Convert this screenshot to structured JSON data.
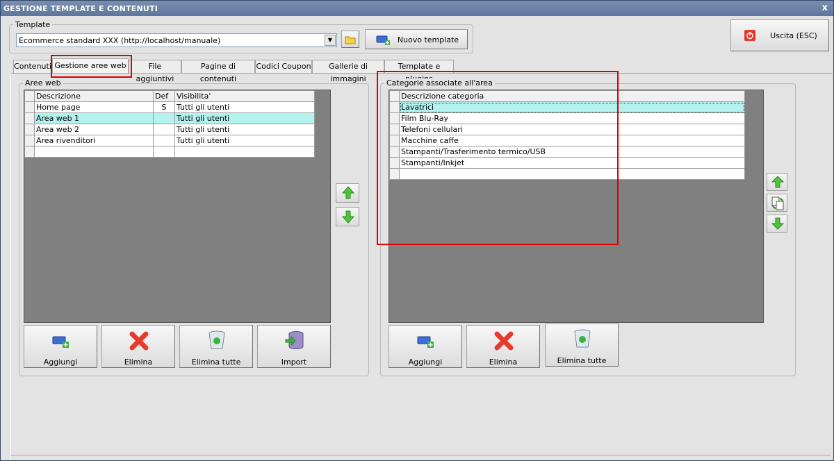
{
  "window": {
    "title": "GESTIONE TEMPLATE E CONTENUTI",
    "close": "x"
  },
  "template": {
    "legend": "Template",
    "selected": "Ecommerce standard XXX (http://localhost/manuale)",
    "new_button": "Nuovo template"
  },
  "exit_button": "Uscita (ESC)",
  "tabs": [
    "Contenuti",
    "Gestione aree web",
    "File aggiuntivi",
    "Pagine di contenuti",
    "Codici Coupon",
    "Gallerie di immagini",
    "Template e plugins"
  ],
  "aree_web": {
    "legend": "Aree web",
    "columns": [
      "Descrizione",
      "Def",
      "Visibilita'"
    ],
    "rows": [
      [
        "Home page",
        "S",
        "Tutti gli utenti"
      ],
      [
        "Area web 1",
        "",
        "Tutti gli utenti"
      ],
      [
        "Area web 2",
        "",
        "Tutti gli utenti"
      ],
      [
        "Area rivenditori",
        "",
        "Tutti gli utenti"
      ],
      [
        "",
        "",
        ""
      ]
    ],
    "buttons": {
      "add": "Aggiungi",
      "delete": "Elimina",
      "delete_all": "Elimina tutte",
      "import": "Import"
    }
  },
  "categorie": {
    "legend": "Categorie associate all'area",
    "column": "Descrizione categoria",
    "rows": [
      "Lavatrici",
      "Film Blu-Ray",
      "Telefoni cellulari",
      "Macchine caffe",
      "Stampanti/Trasferimento termico/USB",
      "Stampanti/Inkjet",
      ""
    ],
    "buttons": {
      "add": "Aggiungi",
      "delete": "Elimina",
      "delete_all": "Elimina tutte"
    }
  },
  "colors": {
    "highlight_row": "#b2f2ef",
    "annotation": "#e00000",
    "titlebar": "#6a7fa2",
    "grid_bg": "#808080"
  }
}
